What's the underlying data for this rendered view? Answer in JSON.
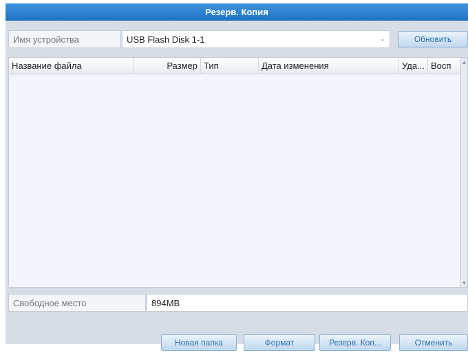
{
  "dialog": {
    "title": "Резерв. Копия"
  },
  "device": {
    "label": "Имя устройства",
    "value": "USB Flash Disk 1-1",
    "refresh_label": "Обновить"
  },
  "table": {
    "columns": [
      "Название файла",
      "Размер",
      "Тип",
      "Дата изменения",
      "Уда...",
      "Восп"
    ],
    "rows": []
  },
  "free_space": {
    "label": "Свободное место",
    "value": "894MB"
  },
  "buttons": {
    "new_folder": "Новая папка",
    "format": "Формат",
    "backup": "Резерв. Коп...",
    "cancel": "Отменить"
  },
  "colors": {
    "titlebar": "#2a80cf",
    "panel": "#d6dde6",
    "button_text": "#2b6ea8"
  }
}
